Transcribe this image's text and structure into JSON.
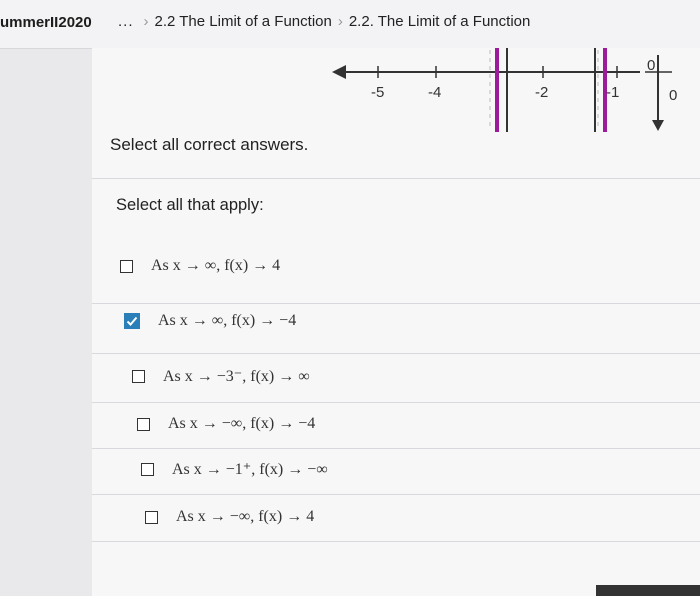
{
  "header": {
    "course": "ummerII2020",
    "dots": "...",
    "crumb1": "2.2 The Limit of a Function",
    "crumb2": "2.2. The Limit of a Function"
  },
  "graph": {
    "tick_labels": [
      "-5",
      "-4",
      "-2",
      "-1",
      "0",
      "0"
    ],
    "asymptote_color": "#9b1b9b"
  },
  "prompt": "Select all correct answers.",
  "apply_label": "Select all that apply:",
  "options": [
    {
      "text": "As x → ∞, f(x) → 4",
      "checked": false
    },
    {
      "text": "As x → ∞, f(x) → −4",
      "checked": true
    },
    {
      "text": "As x → −3⁻, f(x) → ∞",
      "checked": false
    },
    {
      "text": "As x → −∞, f(x) → −4",
      "checked": false
    },
    {
      "text": "As x → −1⁺, f(x) → −∞",
      "checked": false
    },
    {
      "text": "As x → −∞, f(x) → 4",
      "checked": false
    }
  ],
  "colors": {
    "check_blue": "#2a7fb8"
  }
}
